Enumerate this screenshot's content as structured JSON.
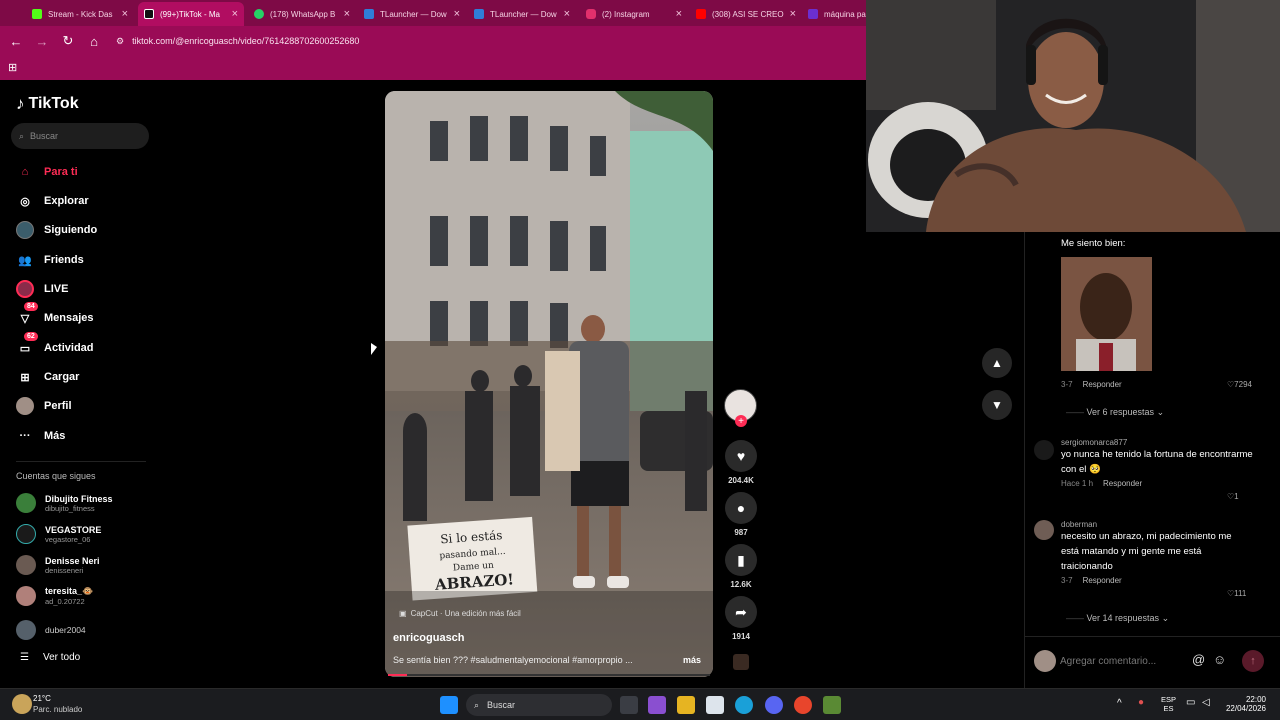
{
  "tabs": [
    {
      "title": "Stream - Kick Das",
      "color": "#53fc18"
    },
    {
      "title": "(99+)TikTok - Ma",
      "color": "#111111"
    },
    {
      "title": "(178) WhatsApp B",
      "color": "#25d366"
    },
    {
      "title": "TLauncher — Dow",
      "color": "#2f7ed8"
    },
    {
      "title": "TLauncher — Dow",
      "color": "#2f7ed8"
    },
    {
      "title": "(2) Instagram",
      "color": "#e1306c"
    },
    {
      "title": "(308) ASI SE CREO",
      "color": "#ff0000"
    },
    {
      "title": "máquina pa",
      "color": "#6b2fd0"
    }
  ],
  "address": {
    "url": "tiktok.com/@enricoguasch/video/7614288702600252680"
  },
  "tiktok": {
    "logo": "TikTok",
    "search_placeholder": "Buscar",
    "nav": [
      {
        "label": "Para ti",
        "icon": "home-icon",
        "active": true
      },
      {
        "label": "Explorar",
        "icon": "compass-icon"
      },
      {
        "label": "Siguiendo",
        "icon": "following-avatar-icon"
      },
      {
        "label": "Friends",
        "icon": "friends-icon"
      },
      {
        "label": "LIVE",
        "icon": "live-icon"
      },
      {
        "label": "Mensajes",
        "icon": "messages-icon",
        "badge": "84"
      },
      {
        "label": "Actividad",
        "icon": "activity-icon",
        "badge": "62"
      },
      {
        "label": "Cargar",
        "icon": "upload-icon"
      },
      {
        "label": "Perfil",
        "icon": "profile-avatar-icon"
      },
      {
        "label": "Más",
        "icon": "more-icon"
      }
    ],
    "following_title": "Cuentas que sigues",
    "following": [
      {
        "name": "Dibujito Fitness",
        "handle": "dibujito_fitness",
        "color": "#3a7f3a"
      },
      {
        "name": "VEGASTORE",
        "handle": "vegastore_06",
        "color": "#1a1a1a"
      },
      {
        "name": "Denisse Neri",
        "handle": "denisseneri",
        "color": "#6a5a52"
      },
      {
        "name": "teresita_🐵",
        "handle": "ad_0.20722",
        "color": "#b0807a"
      },
      {
        "name": "duber2004",
        "handle": "",
        "color": "#55606a"
      }
    ],
    "see_all": "Ver todo"
  },
  "video": {
    "capcut": "CapCut · Una edición más fácil",
    "author": "enricoguasch",
    "caption": "Se sentía bien ??? #saludmentalyemocional #amorpropio ...",
    "more": "más",
    "sign_text": "Si lo estás pasando mal... Dame un ABRAZO!",
    "progress": 0.06
  },
  "actions": {
    "likes": "204.4K",
    "comments": "987",
    "saves": "12.6K",
    "shares": "1914"
  },
  "comments": [
    {
      "text": "Me siento bien:",
      "date": "3-7",
      "reply": "Responder",
      "likes": "7294",
      "view_replies": "Ver 6 respuestas"
    },
    {
      "user": "sergiomonarca877",
      "text": "yo nunca he tenido la fortuna de encontrarme con el 🥺",
      "date": "Hace 1 h",
      "reply": "Responder",
      "likes": "1"
    },
    {
      "user": "doberman",
      "text": "necesito un abrazo, mi padecimiento me está matando y mi gente me está traicionando",
      "date": "3-7",
      "reply": "Responder",
      "likes": "111",
      "view_replies": "Ver 14 respuestas"
    }
  ],
  "comment_input": {
    "placeholder": "Agregar comentario..."
  },
  "taskbar": {
    "weather_temp": "21°C",
    "weather_desc": "Parc. nublado",
    "search": "Buscar",
    "lang1": "ESP",
    "lang2": "ES",
    "time": "22:00",
    "date": "22/04/2026"
  }
}
